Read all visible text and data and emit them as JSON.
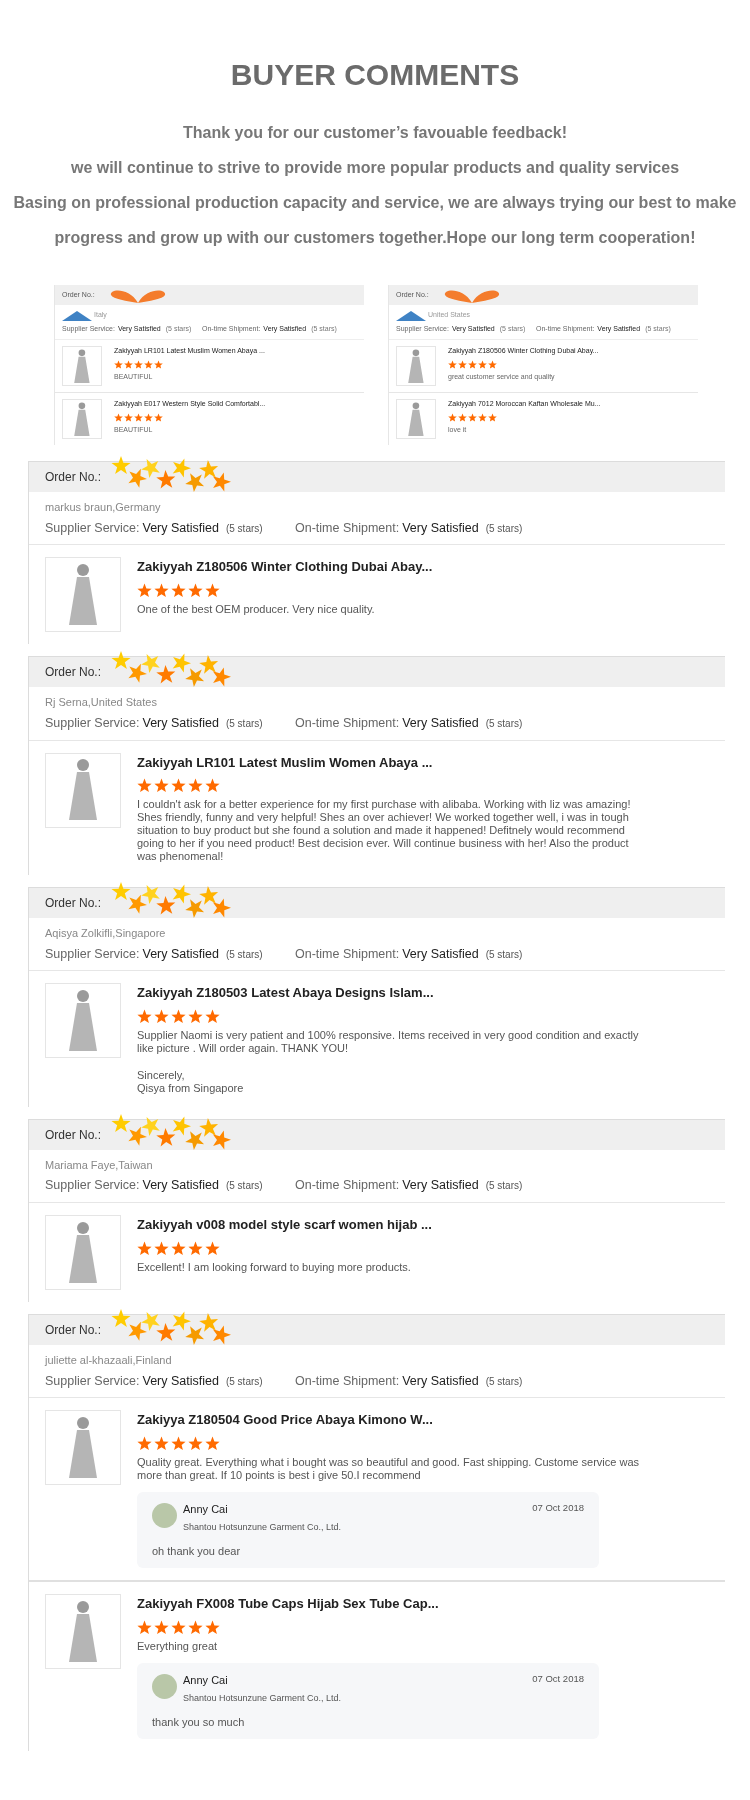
{
  "heading": "BUYER COMMENTS",
  "intro": [
    "Thank you for our customer’s favouable feedback!",
    "we will continue to strive to provide more popular products and quality services",
    "Basing on professional production capacity and service, we are always trying our best to make progress and grow up with our customers together.Hope our long term cooperation!"
  ],
  "screenshots": [
    {
      "order_label": "Order No.:",
      "buyer": "Italy",
      "service_label": "Supplier Service:",
      "service_value": "Very Satisfied",
      "service_stars": "(5 stars)",
      "shipment_label": "On-time Shipment:",
      "shipment_value": "Very Satisfied",
      "shipment_stars": "(5 stars)",
      "items": [
        {
          "title": "Zakiyyah LR101 Latest Muslim Women Abaya ...",
          "stars": 5,
          "comment": [
            "BEAUTIFUL"
          ]
        },
        {
          "title": "Zakiyyah E017 Western Style Solid Comfortabl...",
          "stars": 5,
          "comment": [
            "BEAUTIFUL"
          ]
        }
      ]
    },
    {
      "order_label": "Order No.:",
      "buyer": "United States",
      "service_label": "Supplier Service:",
      "service_value": "Very Satisfied",
      "service_stars": "(5 stars)",
      "shipment_label": "On-time Shipment:",
      "shipment_value": "Very Satisfied",
      "shipment_stars": "(5 stars)",
      "items": [
        {
          "title": "Zakiyyah Z180506 Winter Clothing Dubai Abay...",
          "stars": 5,
          "comment": [
            "great customer service and quality"
          ]
        },
        {
          "title": "Zakiyyah 7012 Moroccan Kaftan Wholesale Mu...",
          "stars": 5,
          "comment": [
            "love it"
          ]
        }
      ]
    }
  ],
  "orders": [
    {
      "order_label": "Order No.:",
      "buyer": "markus braun,Germany",
      "service_label": "Supplier Service:",
      "service_value": "Very Satisfied",
      "service_stars": "(5 stars)",
      "shipment_label": "On-time Shipment:",
      "shipment_value": "Very Satisfied",
      "shipment_stars": "(5 stars)",
      "items": [
        {
          "title": "Zakiyyah Z180506 Winter Clothing Dubai Abay...",
          "stars": 5,
          "comment": [
            "One of the best OEM producer. Very nice quality."
          ]
        }
      ]
    },
    {
      "order_label": "Order No.:",
      "buyer": "Rj Serna,United States",
      "service_label": "Supplier Service:",
      "service_value": "Very Satisfied",
      "service_stars": "(5 stars)",
      "shipment_label": "On-time Shipment:",
      "shipment_value": "Very Satisfied",
      "shipment_stars": "(5 stars)",
      "items": [
        {
          "title": "Zakiyyah LR101 Latest Muslim Women Abaya ...",
          "stars": 5,
          "comment": [
            "I couldn't ask for a better experience for my first purchase with alibaba. Working with liz was amazing! Shes friendly, funny and very helpful! Shes an over achiever! We worked together well, i was in tough situation to buy product but she found a solution and made it happened! Defitnely would recommend going to her if you need product! Best decision ever. Will continue business with her! Also the product was phenomenal!"
          ]
        }
      ]
    },
    {
      "order_label": "Order No.:",
      "buyer": "Aqisya Zolkifli,Singapore",
      "service_label": "Supplier Service:",
      "service_value": "Very Satisfied",
      "service_stars": "(5 stars)",
      "shipment_label": "On-time Shipment:",
      "shipment_value": "Very Satisfied",
      "shipment_stars": "(5 stars)",
      "items": [
        {
          "title": "Zakiyyah Z180503 Latest Abaya Designs Islam...",
          "stars": 5,
          "comment": [
            "Supplier Naomi is very patient and 100% responsive. Items received in very good condition and exactly like picture . Will order again. THANK YOU!",
            "Sincerely,\nQisya from Singapore"
          ]
        }
      ]
    },
    {
      "order_label": "Order No.:",
      "buyer": "Mariama Faye,Taiwan",
      "service_label": "Supplier Service:",
      "service_value": "Very Satisfied",
      "service_stars": "(5 stars)",
      "shipment_label": "On-time Shipment:",
      "shipment_value": "Very Satisfied",
      "shipment_stars": "(5 stars)",
      "items": [
        {
          "title": "Zakiyyah v008 model style scarf women hijab ...",
          "stars": 5,
          "comment": [
            "Excellent! I am looking forward to buying more products."
          ]
        }
      ]
    },
    {
      "order_label": "Order No.:",
      "buyer": "juliette al-khazaali,Finland",
      "service_label": "Supplier Service:",
      "service_value": "Very Satisfied",
      "service_stars": "(5 stars)",
      "shipment_label": "On-time Shipment:",
      "shipment_value": "Very Satisfied",
      "shipment_stars": "(5 stars)",
      "items": [
        {
          "title": "Zakiyya Z180504 Good Price Abaya Kimono W...",
          "stars": 5,
          "comment": [
            "Quality great. Everything what i bought was so beautiful and good. Fast shipping. Custome service was more than great. If 10 points is best i give 50.I recommend"
          ],
          "reply": {
            "name": "Anny Cai",
            "company": "Shantou Hotsunzune Garment Co., Ltd.",
            "date": "07 Oct 2018",
            "text": "oh thank you dear"
          }
        },
        {
          "title": "Zakiyyah FX008 Tube Caps Hijab Sex Tube Cap...",
          "stars": 5,
          "comment": [
            "Everything great"
          ],
          "reply": {
            "name": "Anny Cai",
            "company": "Shantou Hotsunzune Garment Co., Ltd.",
            "date": "07 Oct 2018",
            "text": "thank you so much"
          }
        }
      ]
    }
  ]
}
